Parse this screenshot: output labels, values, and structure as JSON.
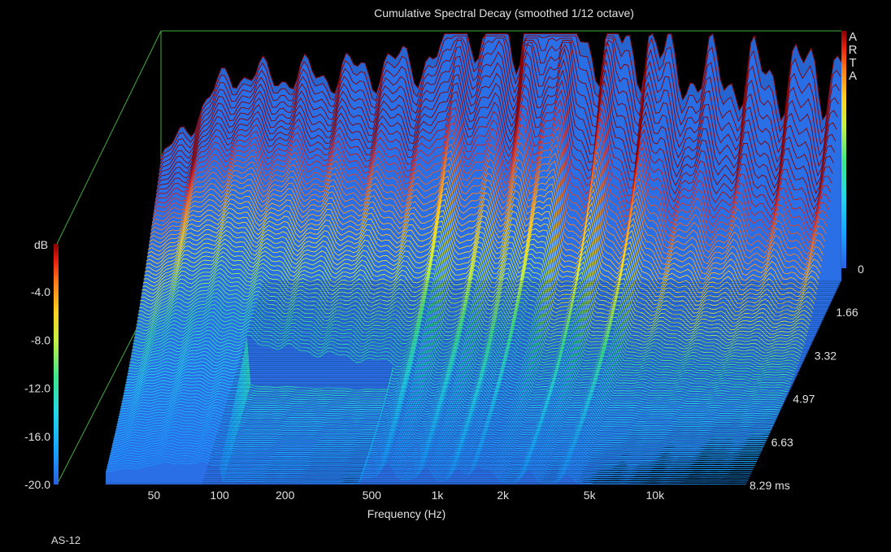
{
  "chart_data": {
    "type": "waterfall",
    "title": "Cumulative Spectral Decay (smoothed 1/12 octave)",
    "xlabel": "Frequency (Hz)",
    "ylabel": "dB",
    "zlabel_unit": "ms",
    "x_scale": "log",
    "x_ticks": [
      "50",
      "100",
      "200",
      "500",
      "1k",
      "2k",
      "5k",
      "10k"
    ],
    "x_tick_values": [
      50,
      100,
      200,
      500,
      1000,
      2000,
      5000,
      10000
    ],
    "xlim": [
      30,
      20000
    ],
    "y_ticks": [
      "-4.0",
      "-8.0",
      "-12.0",
      "-16.0",
      "-20.0"
    ],
    "ylim": [
      -20,
      0
    ],
    "time_ticks": [
      "0",
      "1.66",
      "3.32",
      "4.97",
      "6.63",
      "8.29 ms"
    ],
    "time_range_ms": [
      0,
      8.29
    ],
    "slices": 100,
    "colormap": [
      "#2a60e0",
      "#17a6ff",
      "#22d8e8",
      "#3ee88a",
      "#c8f040",
      "#ffd020",
      "#ff7a18",
      "#e82010",
      "#8a0000"
    ],
    "floor_color": "#2a6fe6",
    "grid_color": "#3fae3f",
    "watermark": [
      "A",
      "R",
      "T",
      "A"
    ],
    "footer": "AS-12"
  }
}
